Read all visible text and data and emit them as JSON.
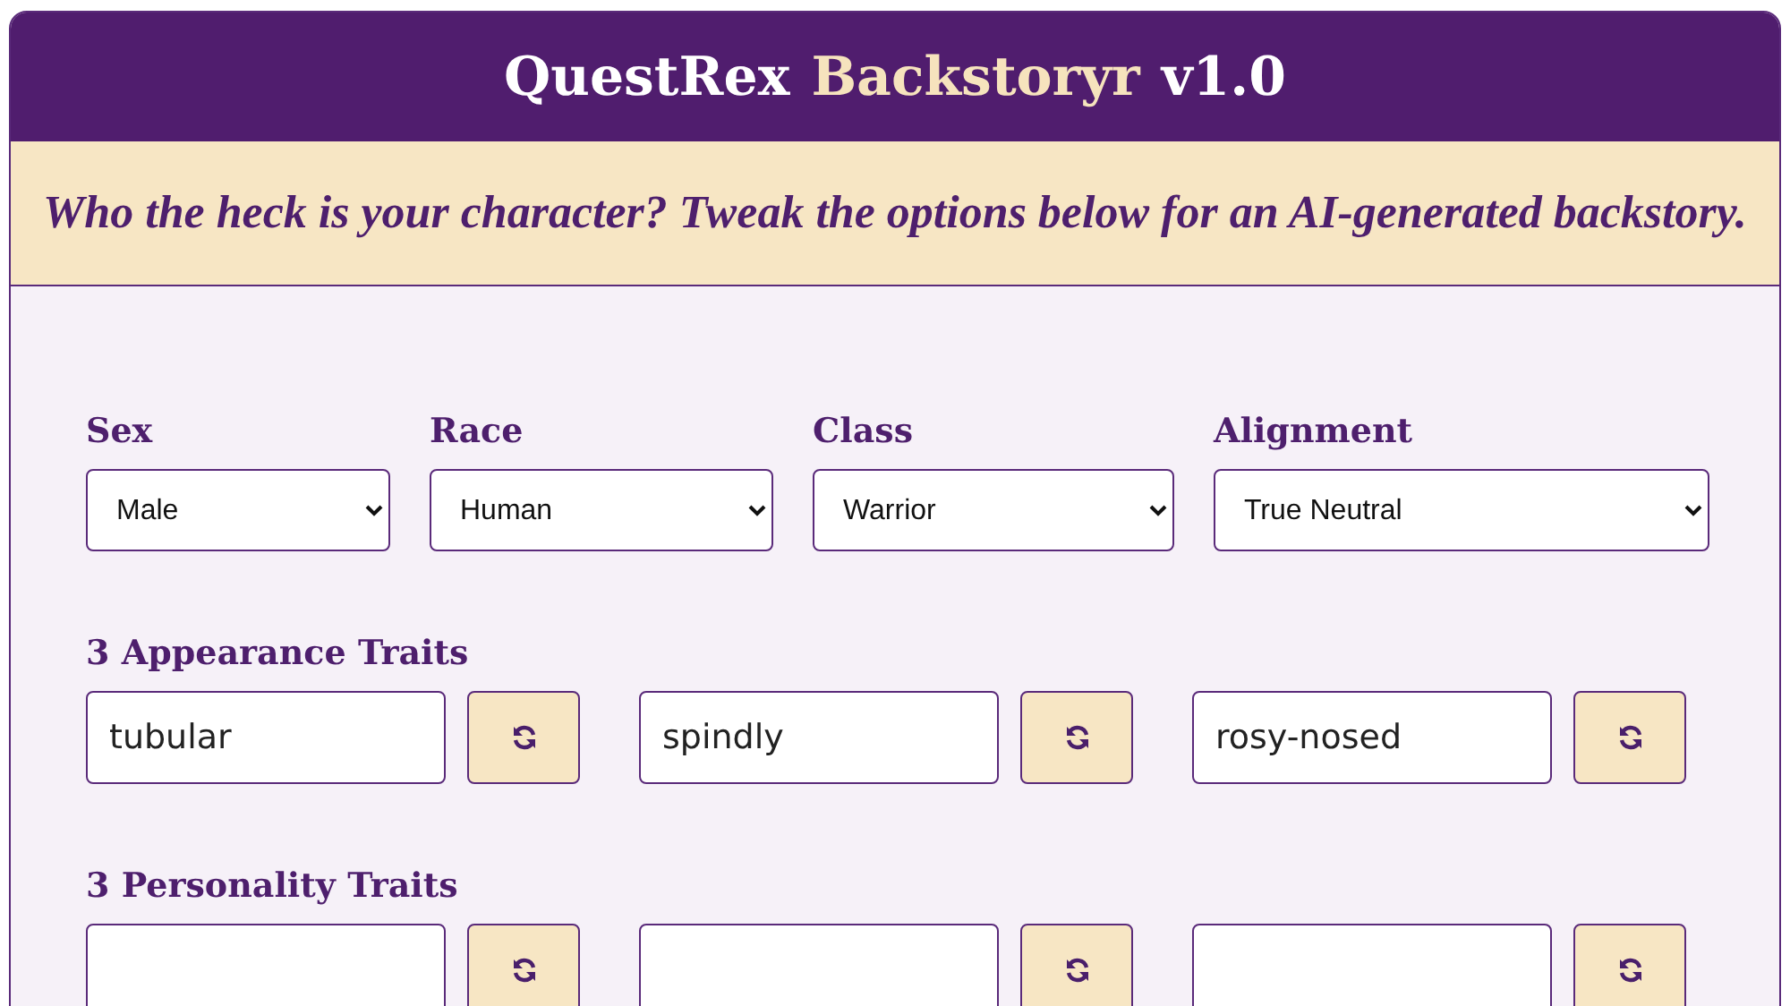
{
  "header": {
    "title_parts": [
      {
        "text": "QuestRex",
        "highlight": false
      },
      {
        "text": "Backstoryr",
        "highlight": true
      },
      {
        "text": "v1.0",
        "highlight": false
      }
    ]
  },
  "tagline": "Who the heck is your character? Tweak the options below for an AI-generated backstory.",
  "selects": [
    {
      "label": "Sex",
      "value": "Male"
    },
    {
      "label": "Race",
      "value": "Human"
    },
    {
      "label": "Class",
      "value": "Warrior"
    },
    {
      "label": "Alignment",
      "value": "True Neutral"
    }
  ],
  "trait_groups": [
    {
      "title": "3 Appearance Traits",
      "traits": [
        {
          "kind": "text",
          "value": "tubular"
        },
        {
          "kind": "text",
          "value": "spindly"
        },
        {
          "kind": "text",
          "value": "rosy-nosed"
        }
      ]
    },
    {
      "title": "3 Personality Traits",
      "traits": [
        {
          "kind": "blank"
        },
        {
          "kind": "blank"
        },
        {
          "kind": "blank"
        }
      ]
    }
  ]
}
